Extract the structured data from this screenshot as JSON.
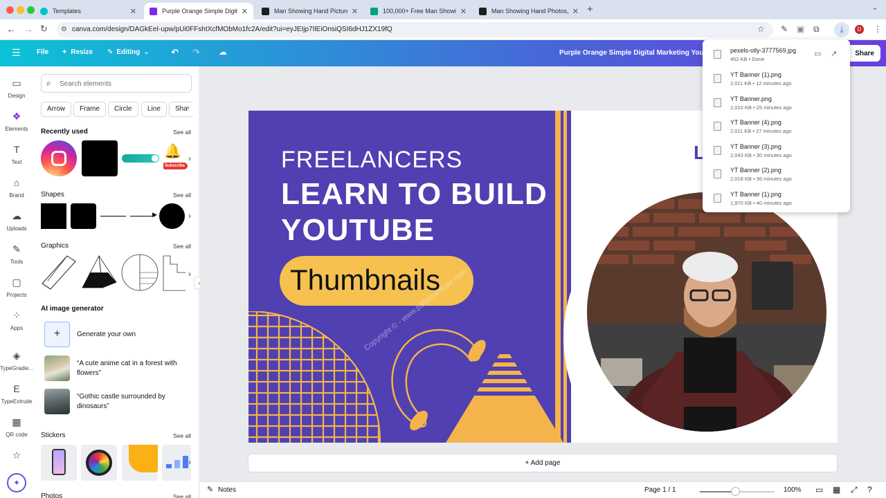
{
  "browser": {
    "tabs": [
      {
        "title": "Templates",
        "favicon_color": "#00c4cc"
      },
      {
        "title": "Purple Orange Simple Digital",
        "favicon_color": "#7d2ae8"
      },
      {
        "title": "Man Showing Hand Pictures |",
        "favicon_color": "#1f1f1f"
      },
      {
        "title": "100,000+ Free Man Showing",
        "favicon_color": "#05a081"
      },
      {
        "title": "Man Showing Hand Photos, D",
        "favicon_color": "#1f1f1f"
      }
    ],
    "active_tab_index": 1,
    "url": "canva.com/design/DAGkEeI-upw/pUi0FFshtXcfMObMo1fc2A/edit?ui=eyJEIjp7IlEiOnsiQSI6dHJ1ZX19fQ",
    "profile_initial": "D"
  },
  "toolbar": {
    "file_label": "File",
    "resize_label": "Resize",
    "editing_label": "Editing",
    "doc_title": "Purple Orange Simple Digital Marketing Youtu",
    "share_label": "Share"
  },
  "rail": {
    "items": [
      {
        "label": "Design",
        "icon": "design-icon"
      },
      {
        "label": "Elements",
        "icon": "elements-icon"
      },
      {
        "label": "Text",
        "icon": "text-icon"
      },
      {
        "label": "Brand",
        "icon": "brand-icon"
      },
      {
        "label": "Uploads",
        "icon": "uploads-icon"
      },
      {
        "label": "Tools",
        "icon": "tools-icon"
      },
      {
        "label": "Projects",
        "icon": "projects-icon"
      },
      {
        "label": "Apps",
        "icon": "apps-icon"
      },
      {
        "label": "TypeGradie...",
        "icon": "typegradient-icon"
      },
      {
        "label": "TypeExtrude",
        "icon": "typeextrude-icon"
      },
      {
        "label": "QR code",
        "icon": "qr-code-icon"
      }
    ],
    "active_index": 1
  },
  "panel": {
    "search_placeholder": "Search elements",
    "chips": [
      "Arrow",
      "Frame",
      "Circle",
      "Line",
      "Sha"
    ],
    "recently_used_title": "Recently used",
    "shapes_title": "Shapes",
    "graphics_title": "Graphics",
    "ai_title": "AI image generator",
    "stickers_title": "Stickers",
    "photos_title": "Photos",
    "see_all": "See all",
    "generate_label": "Generate your own",
    "prompts": [
      "“A cute anime cat in a forest with flowers”",
      "“Gothic castle surrounded by dinosaurs”"
    ],
    "subscribe_label": "Subscribe"
  },
  "design": {
    "line1": "FREELANCERS",
    "line2": "LEARN TO BUILD",
    "line3": "YOUTUBE",
    "pill": "Thumbnails",
    "watermark": "Copyright © - www.p30download.com",
    "partial_letter": "L",
    "colors": {
      "purple": "#5040b1",
      "yellow": "#f4b44b",
      "pill": "#f6c14f"
    }
  },
  "add_page_label": "+ Add page",
  "bottom": {
    "notes_label": "Notes",
    "page_label": "Page 1 / 1",
    "zoom_label": "100%",
    "zoom_fraction": 0.47
  },
  "downloads": [
    {
      "name": "pexels-olly-3777569.jpg",
      "meta": "452 KB • Done"
    },
    {
      "name": "YT Banner (1).png",
      "meta": "2,011 KB • 12 minutes ago"
    },
    {
      "name": "YT Banner.png",
      "meta": "2,010 KB • 25 minutes ago"
    },
    {
      "name": "YT Banner (4).png",
      "meta": "2,011 KB • 27 minutes ago"
    },
    {
      "name": "YT Banner (3).png",
      "meta": "2,043 KB • 30 minutes ago"
    },
    {
      "name": "YT Banner (2).png",
      "meta": "2,018 KB • 36 minutes ago"
    },
    {
      "name": "YT Banner (1).png",
      "meta": "1,970 KB • 40 minutes ago"
    }
  ]
}
